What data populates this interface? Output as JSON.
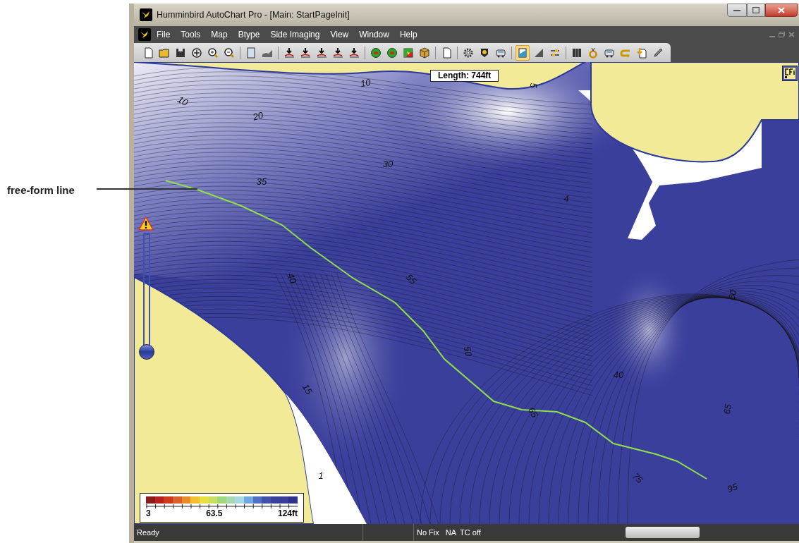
{
  "window": {
    "title": "Humminbird AutoChart Pro - [Main: StartPageInit]"
  },
  "menu": [
    "File",
    "Tools",
    "Map",
    "Btype",
    "Side Imaging",
    "View",
    "Window",
    "Help"
  ],
  "toolbar": [
    {
      "kind": "new",
      "selected": false
    },
    {
      "kind": "open",
      "selected": false
    },
    {
      "kind": "save",
      "selected": false
    },
    {
      "kind": "target",
      "selected": false
    },
    {
      "kind": "zoom-in",
      "selected": false
    },
    {
      "kind": "zoom-out",
      "selected": false
    },
    {
      "kind": "page",
      "selected": false
    },
    {
      "kind": "area",
      "selected": false
    },
    {
      "kind": "arrow-chart",
      "selected": false
    },
    {
      "kind": "arrow-chart",
      "selected": false
    },
    {
      "kind": "arrow-chart",
      "selected": false
    },
    {
      "kind": "arrow-chart",
      "selected": false
    },
    {
      "kind": "arrow-chart",
      "selected": false
    },
    {
      "kind": "disc",
      "selected": false
    },
    {
      "kind": "disc",
      "selected": false
    },
    {
      "kind": "heat-square",
      "selected": false
    },
    {
      "kind": "cube",
      "selected": false
    },
    {
      "kind": "new",
      "selected": false
    },
    {
      "kind": "gear",
      "selected": false
    },
    {
      "kind": "pin",
      "selected": false
    },
    {
      "kind": "vehicle",
      "selected": false
    },
    {
      "kind": "profile",
      "selected": true
    },
    {
      "kind": "wedge",
      "selected": false
    },
    {
      "kind": "sliders",
      "selected": false
    },
    {
      "kind": "columns",
      "selected": false
    },
    {
      "kind": "ring",
      "selected": false
    },
    {
      "kind": "vehicle",
      "selected": false
    },
    {
      "kind": "return",
      "selected": false
    },
    {
      "kind": "doc-arrow",
      "selected": false
    },
    {
      "kind": "pencil",
      "selected": false
    }
  ],
  "map": {
    "measure_label": "Length: 744ft",
    "depth_labels": [
      "10",
      "20",
      "10",
      "5",
      "30",
      "35",
      "4",
      "40",
      "55",
      "60",
      "50",
      "40",
      "15",
      "65",
      "65",
      "1",
      "75",
      "95"
    ],
    "depth_slider": {
      "level": 0
    },
    "legend": {
      "labels": [
        "3",
        "63.5",
        "124ft"
      ]
    }
  },
  "annotation": {
    "label": "free-form line"
  },
  "status_bar": {
    "panels": [
      "Ready",
      "No Fix",
      "NA",
      "TC off"
    ]
  }
}
